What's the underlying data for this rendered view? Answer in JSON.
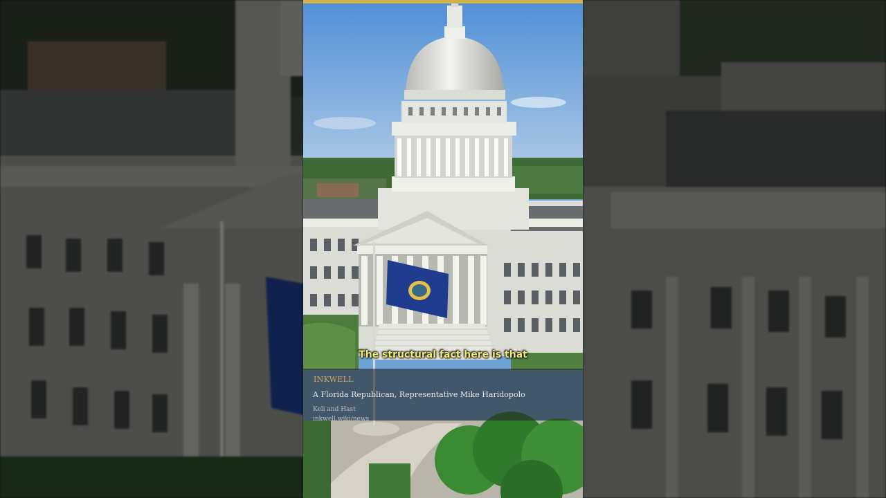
{
  "video": {
    "caption": "The structural fact here is that"
  },
  "info_card": {
    "brand": "INKWELL",
    "headline": "A Florida Republican, Representative Mike Haridopolo",
    "authors": "Keli and Hast",
    "url": "inkwell.wiki/news"
  },
  "colors": {
    "accent_bar": "#d2b24a",
    "caption_text": "#f2ec6e",
    "brand_text": "#cfa85a",
    "flag_blue": "#1f3c8f"
  }
}
